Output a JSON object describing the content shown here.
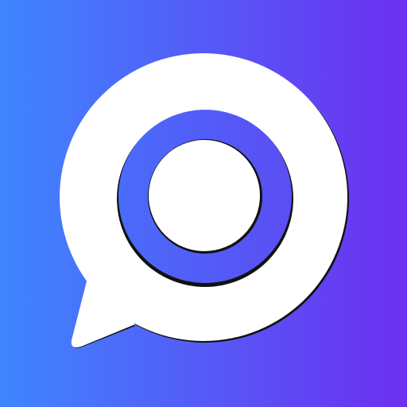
{
  "icon": {
    "name": "chat-bubble-ring-logo",
    "colors": {
      "gradient_start": "#3e86fe",
      "gradient_end": "#6c2ff0",
      "bubble": "#ffffff",
      "outline": "#111111"
    }
  }
}
